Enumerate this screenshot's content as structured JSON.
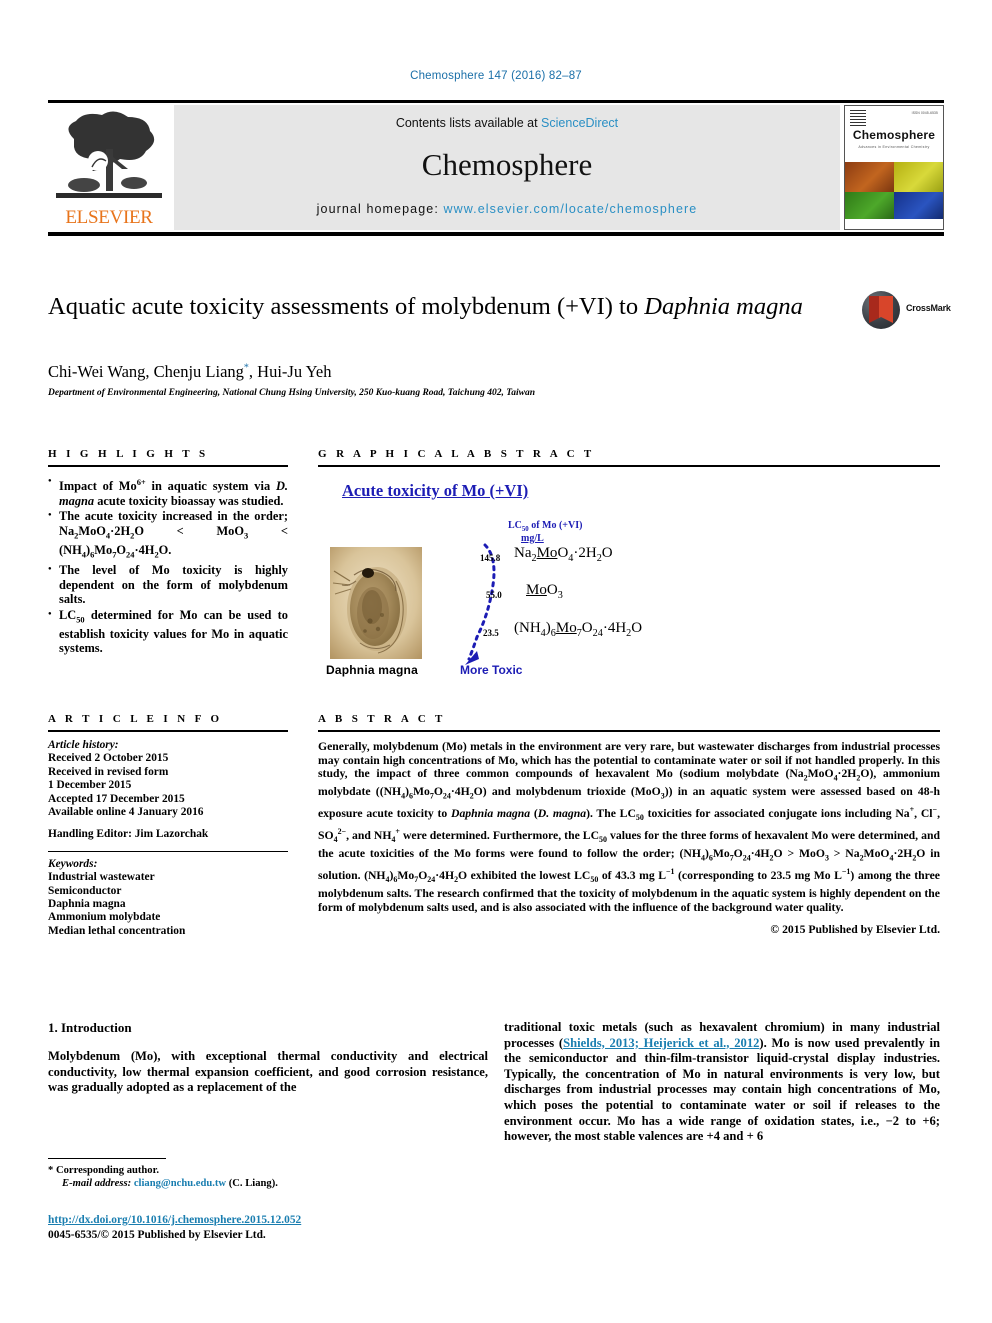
{
  "running_head": "Chemosphere 147 (2016) 82–87",
  "masthead": {
    "contents_prefix": "Contents lists available at ",
    "contents_link": "ScienceDirect",
    "journal_name": "Chemosphere",
    "homepage_prefix": "journal homepage: ",
    "homepage_link": "www.elsevier.com/locate/chemosphere",
    "publisher_logo_text": "ELSEVIER",
    "publisher_logo_icon": "elsevier-tree-logo",
    "cover": {
      "title": "Chemosphere",
      "subtitle": "Advances in Environmental Chemistry",
      "grid_colors": [
        "#b4541e",
        "#c9c117",
        "#3f8f1e",
        "#1b3fa0"
      ]
    }
  },
  "article": {
    "title_part1": "Aquatic acute toxicity assessments of molybdenum (+VI) to ",
    "title_italic": "Daphnia magna",
    "authors": "Chi-Wei Wang, Chenju Liang",
    "author_marker": "*",
    "authors_tail": ", Hui-Ju Yeh",
    "affiliation": "Department of Environmental Engineering, National Chung Hsing University, 250 Kuo-kuang Road, Taichung 402, Taiwan",
    "crossmark_label": "CrossMark",
    "crossmark_icon": "crossmark-logo"
  },
  "highlights": {
    "heading": "H I G H L I G H T S",
    "items": [
      "Impact of Mo<sup>6+</sup> in aquatic system via <i>D. magna</i> acute toxicity bioassay was studied.",
      "The acute toxicity increased in the order; Na<sub>2</sub>MoO<sub>4</sub>·2H<sub>2</sub>O &lt; MoO<sub>3</sub> &lt; (NH<sub>4</sub>)<sub>6</sub>Mo<sub>7</sub>O<sub>24</sub>·4H<sub>2</sub>O.",
      "The level of Mo toxicity is highly dependent on the form of molybdenum salts.",
      "LC<sub>50</sub> determined for Mo can be used to establish toxicity values for Mo in aquatic systems."
    ]
  },
  "graphical_abstract": {
    "heading": "G R A P H I C A L   A B S T R A C T",
    "figure_title": "Acute toxicity of Mo (+VI)",
    "axis_label_line1": "LC<sub>50</sub> of Mo (+VI)",
    "axis_label_line2": "mg/L",
    "photo_caption": "Daphnia magna",
    "photo_alt": "daphnia-magna-micrograph",
    "arrow_label": "More Toxic",
    "values": [
      {
        "value": "145.8",
        "formula": "Na<sub>2</sub><span class=\"u\">Mo</span>O<sub>4</sub>·2H<sub>2</sub>O"
      },
      {
        "value": "55.0",
        "formula": "<span class=\"u\">Mo</span>O<sub>3</sub>"
      },
      {
        "value": "23.5",
        "formula": "(NH<sub>4</sub>)<sub>6</sub><span class=\"u\">Mo</span><sub>7</sub>O<sub>24</sub>·4H<sub>2</sub>O"
      }
    ],
    "accent_color": "#1c1cb4"
  },
  "article_info": {
    "heading": "A R T I C L E   I N F O",
    "history_label": "Article history:",
    "history": [
      "Received 2 October 2015",
      "Received in revised form",
      "1 December 2015",
      "Accepted 17 December 2015",
      "Available online 4 January 2016"
    ],
    "handling_editor": "Handling Editor: Jim Lazorchak",
    "keywords_label": "Keywords:",
    "keywords": [
      "Industrial wastewater",
      "Semiconductor",
      "Daphnia magna",
      "Ammonium molybdate",
      "Median lethal concentration"
    ]
  },
  "abstract": {
    "heading": "A B S T R A C T",
    "text": "Generally, molybdenum (Mo) metals in the environment are very rare, but wastewater discharges from industrial processes may contain high concentrations of Mo, which has the potential to contaminate water or soil if not handled properly. In this study, the impact of three common compounds of hexavalent Mo (sodium molybdate (Na<sub>2</sub>MoO<sub>4</sub>·2H<sub>2</sub>O), ammonium molybdate ((NH<sub>4</sub>)<sub>6</sub>Mo<sub>7</sub>O<sub>24</sub>·4H<sub>2</sub>O) and molybdenum trioxide (MoO<sub>3</sub>)) in an aquatic system were assessed based on 48-h exposure acute toxicity to <i>Daphnia magna</i> (<i>D. magna</i>). The LC<sub>50</sub> toxicities for associated conjugate ions including Na<sup>+</sup>, Cl<sup>−</sup>, SO<sub>4</sub><sup>2−</sup>, and NH<sub>4</sub><sup>+</sup> were determined. Furthermore, the LC<sub>50</sub> values for the three forms of hexavalent Mo were determined, and the acute toxicities of the Mo forms were found to follow the order; (NH<sub>4</sub>)<sub>6</sub>Mo<sub>7</sub>O<sub>24</sub>·4H<sub>2</sub>O &gt; MoO<sub>3</sub> &gt; Na<sub>2</sub>MoO<sub>4</sub>·2H<sub>2</sub>O in solution. (NH<sub>4</sub>)<sub>6</sub>Mo<sub>7</sub>O<sub>24</sub>·4H<sub>2</sub>O exhibited the lowest LC<sub>50</sub> of 43.3 mg L<sup>−1</sup> (corresponding to 23.5 mg Mo L<sup>−1</sup>) among the three molybdenum salts. The research confirmed that the toxicity of molybdenum in the aquatic system is highly dependent on the form of molybdenum salts used, and is also associated with the influence of the background water quality.",
    "copyright": "© 2015 Published by Elsevier Ltd."
  },
  "introduction": {
    "heading": "1. Introduction",
    "col_left": "Molybdenum (Mo), with exceptional thermal conductivity and electrical conductivity, low thermal expansion coefficient, and good corrosion resistance, was gradually adopted as a replacement of the",
    "col_right_pre": "traditional toxic metals (such as hexavalent chromium) in many industrial processes (",
    "col_right_cite": "Shields, 2013; Heijerick et al., 2012",
    "col_right_post": "). Mo is now used prevalently in the semiconductor and thin-film-transistor liquid-crystal display industries. Typically, the concentration of Mo in natural environments is very low, but discharges from industrial processes may contain high concentrations of Mo, which poses the potential to contaminate water or soil if releases to the environment occur. Mo has a wide range of oxidation states, i.e., −2 to +6; however, the most stable valences are +4 and + 6"
  },
  "footer": {
    "corresponding_marker": "*",
    "corresponding_text": "Corresponding author.",
    "email_label": "E-mail address:",
    "email": "cliang@nchu.edu.tw",
    "email_suffix": "(C. Liang).",
    "doi": "http://dx.doi.org/10.1016/j.chemosphere.2015.12.052",
    "issn_line": "0045-6535/© 2015 Published by Elsevier Ltd."
  }
}
